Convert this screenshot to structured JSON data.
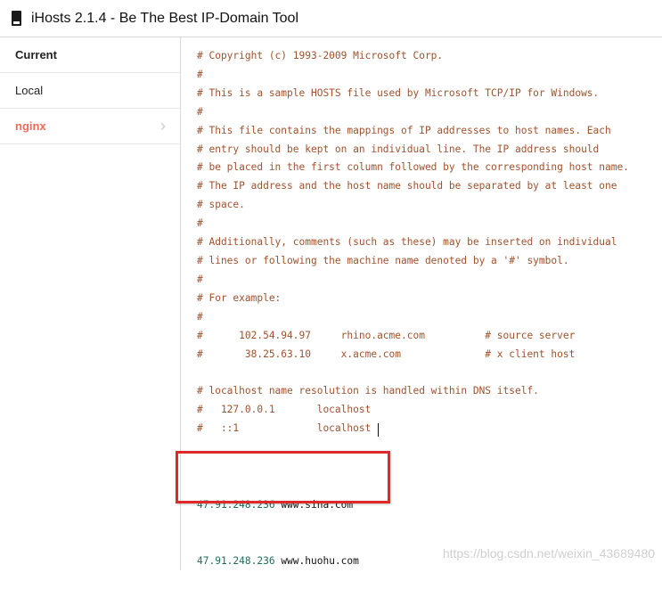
{
  "window": {
    "title": "iHosts 2.1.4 - Be The Best IP-Domain Tool"
  },
  "sidebar": {
    "items": [
      {
        "label": "Current"
      },
      {
        "label": "Local"
      },
      {
        "label": "nginx"
      }
    ]
  },
  "editor": {
    "comment_text": "# Copyright (c) 1993-2009 Microsoft Corp.\n#\n# This is a sample HOSTS file used by Microsoft TCP/IP for Windows.\n#\n# This file contains the mappings of IP addresses to host names. Each\n# entry should be kept on an individual line. The IP address should\n# be placed in the first column followed by the corresponding host name.\n# The IP address and the host name should be separated by at least one\n# space.\n#\n# Additionally, comments (such as these) may be inserted on individual\n# lines or following the machine name denoted by a '#' symbol.\n#\n# For example:\n#\n#      102.54.94.97     rhino.acme.com          # source server\n#       38.25.63.10     x.acme.com              # x client host\n\n# localhost name resolution is handled within DNS itself.\n#   127.0.0.1       localhost\n#   ::1             localhost",
    "entries": [
      {
        "ip": "47.91.248.236",
        "domain": "www.sina.com"
      },
      {
        "ip": "47.91.248.236",
        "domain": "www.huohu.com"
      }
    ]
  },
  "watermark": "https://blog.csdn.net/weixin_43689480",
  "colors": {
    "active_item": "#ee6b55",
    "comment": "#a0522d",
    "ip": "#1f6e5a",
    "highlight_box": "#e02828"
  },
  "icons": {
    "app": "app-icon",
    "chevron": "chevron-right-icon"
  }
}
